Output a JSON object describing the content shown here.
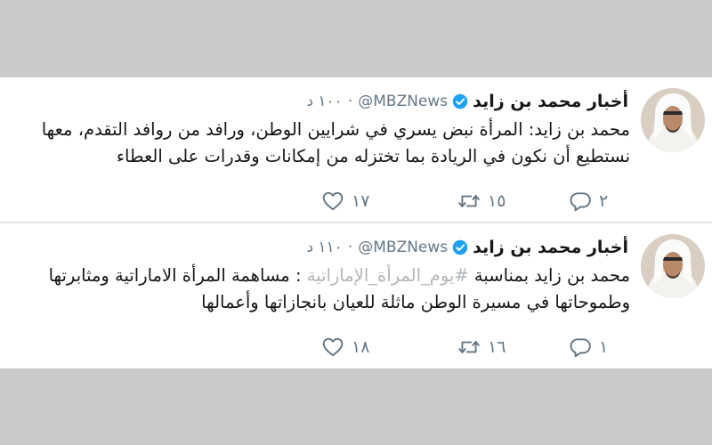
{
  "tweets": [
    {
      "author_name": "أخبار محمد بن زايد",
      "handle": "@MBZNews",
      "time": "١٠٠ د",
      "text_before": "محمد بن زايد: المرأة نبض يسري في شرايين الوطن، ورافد من روافد التقدم، معها نستطيع أن نكون في الريادة بما تختزله من إمكانات وقدرات على العطاء",
      "hashtag": "",
      "text_after": "",
      "reply_count": "٢",
      "retweet_count": "١٥",
      "like_count": "١٧"
    },
    {
      "author_name": "أخبار محمد بن زايد",
      "handle": "@MBZNews",
      "time": "١١٠ د",
      "text_before": "محمد بن زايد بمناسبة ",
      "hashtag": "#يوم_المرأة_الإماراتية",
      "text_after": " : مساهمة المرأة الاماراتية ومثابرتها وطموحاتها في مسيرة الوطن ماثلة للعيان بانجازاتها وأعمالها",
      "reply_count": "١",
      "retweet_count": "١٦",
      "like_count": "١٨"
    }
  ],
  "icons": {
    "reply": "reply-icon",
    "retweet": "retweet-icon",
    "like": "heart-icon",
    "verified": "verified-badge-icon",
    "avatar": "avatar-photo"
  },
  "colors": {
    "background": "#c9cacc",
    "card": "#ffffff",
    "text": "#14171a",
    "muted": "#657786",
    "verified": "#1da1f2",
    "hashtag": "#b2b6ba"
  }
}
